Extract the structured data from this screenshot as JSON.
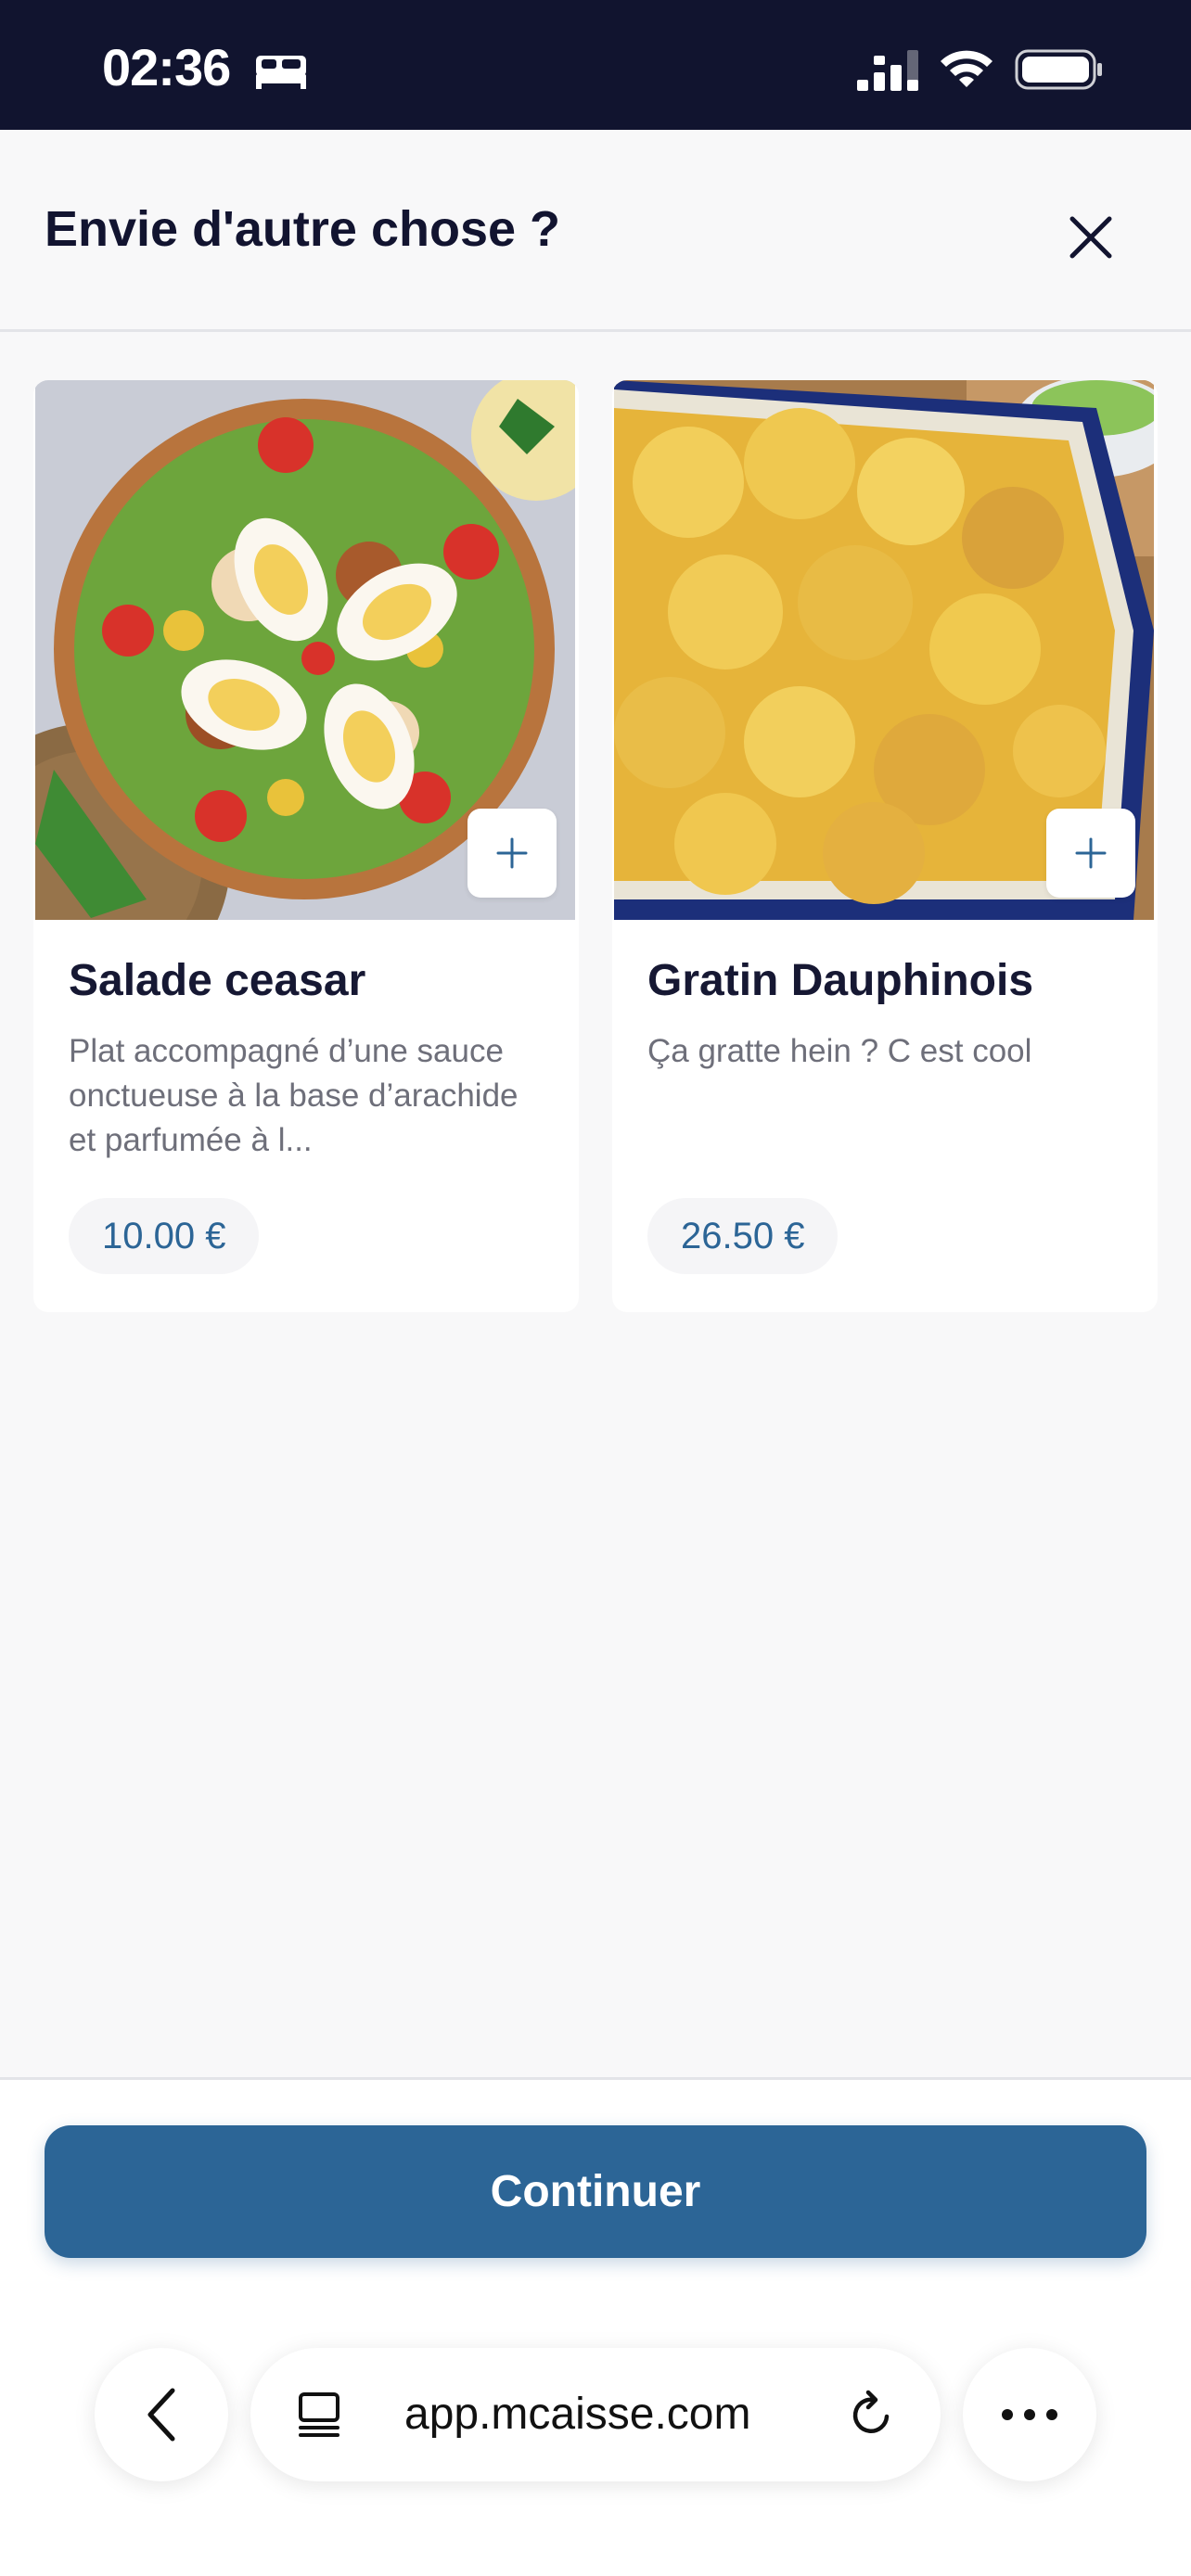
{
  "status_bar": {
    "time": "02:36",
    "icons": [
      "bed-icon",
      "signal-icon",
      "wifi-icon",
      "battery-icon"
    ]
  },
  "header": {
    "title": "Envie d'autre chose ?",
    "close_icon": "close-icon"
  },
  "products": [
    {
      "name": "Salade ceasar",
      "description": "Plat accompagné d’une sauce onctueuse à la base d’arachide et parfumée à l...",
      "price": "10.00 €",
      "image": "caesar-salad-photo",
      "add_icon": "plus-icon"
    },
    {
      "name": "Gratin Dauphinois",
      "description": "Ça gratte hein ? C est cool",
      "price": "26.50 €",
      "image": "gratin-dauphinois-photo",
      "add_icon": "plus-icon"
    }
  ],
  "footer": {
    "continue_label": "Continuer"
  },
  "browser": {
    "url": "app.mcaisse.com",
    "icons": [
      "back-icon",
      "tab-icon",
      "reload-icon",
      "more-icon"
    ]
  },
  "colors": {
    "status_bar_bg": "#11142f",
    "accent": "#2c6596",
    "background": "#f8f8f9",
    "title_text": "#161833",
    "description_text": "#6e6f7a"
  }
}
